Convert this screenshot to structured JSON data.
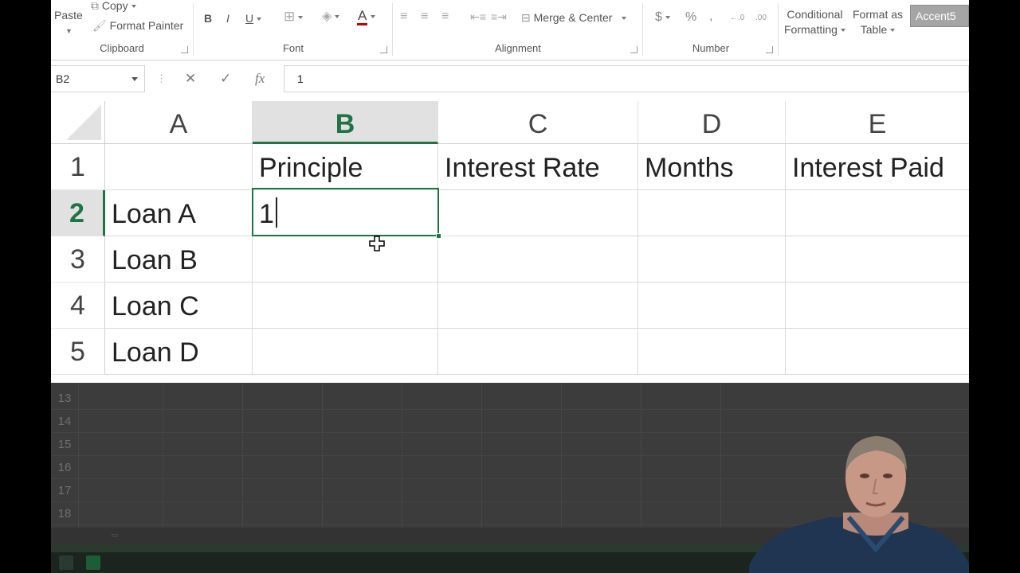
{
  "ribbon": {
    "clipboard": {
      "paste_label": "Paste",
      "copy_label": "Copy",
      "format_painter_label": "Format Painter",
      "group_label": "Clipboard"
    },
    "font": {
      "bold": "B",
      "italic": "I",
      "underline": "U",
      "font_color_glyph": "A",
      "group_label": "Font"
    },
    "alignment": {
      "merge_center_label": "Merge & Center",
      "group_label": "Alignment"
    },
    "number": {
      "currency": "$",
      "percent": "%",
      "comma": ",",
      "inc_decimal": "←.0",
      "dec_decimal": ".00",
      "group_label": "Number"
    },
    "styles": {
      "conditional_line1": "Conditional",
      "conditional_line2": "Formatting",
      "format_table_line1": "Format as",
      "format_table_line2": "Table",
      "cell_style": "Accent5"
    }
  },
  "formula_bar": {
    "name_box": "B2",
    "cancel_glyph": "✕",
    "enter_glyph": "✓",
    "fx_glyph": "fx",
    "content": "1"
  },
  "sheet": {
    "columns": [
      "A",
      "B",
      "C",
      "D",
      "E"
    ],
    "selected_column": "B",
    "rows": [
      "1",
      "2",
      "3",
      "4",
      "5"
    ],
    "selected_row": "2",
    "cells": {
      "B1": "Principle",
      "C1": "Interest Rate",
      "D1": "Months",
      "E1": "Interest Paid",
      "A2": "Loan A",
      "B2": "1",
      "A3": "Loan B",
      "A4": "Loan C",
      "A5": "Loan D"
    },
    "lower_rows": [
      "13",
      "14",
      "15",
      "16",
      "17",
      "18"
    ]
  },
  "colors": {
    "accent": "#217346",
    "header_selected_bg": "#e1e1e1"
  }
}
